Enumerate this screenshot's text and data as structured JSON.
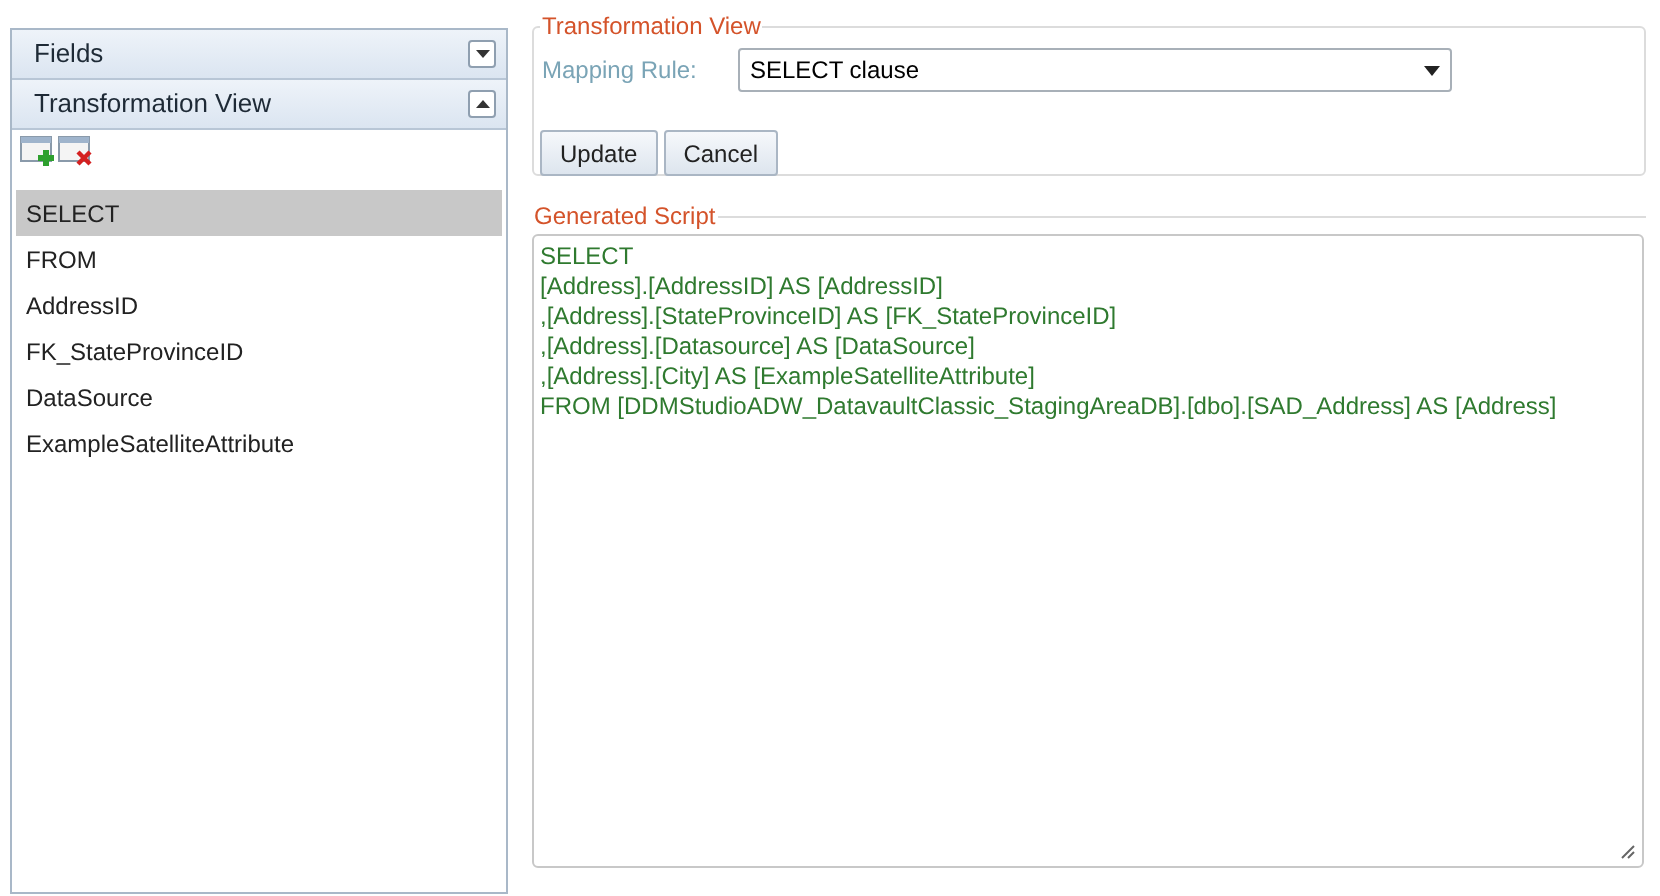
{
  "sidebar": {
    "sections": [
      {
        "title": "Fields",
        "expanded": false
      },
      {
        "title": "Transformation View",
        "expanded": true
      }
    ],
    "items": [
      {
        "label": "SELECT",
        "selected": true
      },
      {
        "label": "FROM",
        "selected": false
      },
      {
        "label": "AddressID",
        "selected": false
      },
      {
        "label": "FK_StateProvinceID",
        "selected": false
      },
      {
        "label": "DataSource",
        "selected": false
      },
      {
        "label": "ExampleSatelliteAttribute",
        "selected": false
      }
    ]
  },
  "transformation_view": {
    "legend": "Transformation View",
    "mapping_rule_label": "Mapping Rule:",
    "mapping_rule_value": "SELECT clause",
    "buttons": [
      "Update",
      "Cancel"
    ]
  },
  "generated_script": {
    "legend": "Generated Script",
    "lines": [
      "SELECT",
      "[Address].[AddressID] AS [AddressID]",
      ",[Address].[StateProvinceID] AS [FK_StateProvinceID]",
      ",[Address].[Datasource] AS [DataSource]",
      ",[Address].[City] AS [ExampleSatelliteAttribute]",
      "FROM [DDMStudioADW_DatavaultClassic_StagingAreaDB].[dbo].[SAD_Address] AS [Address]"
    ]
  }
}
